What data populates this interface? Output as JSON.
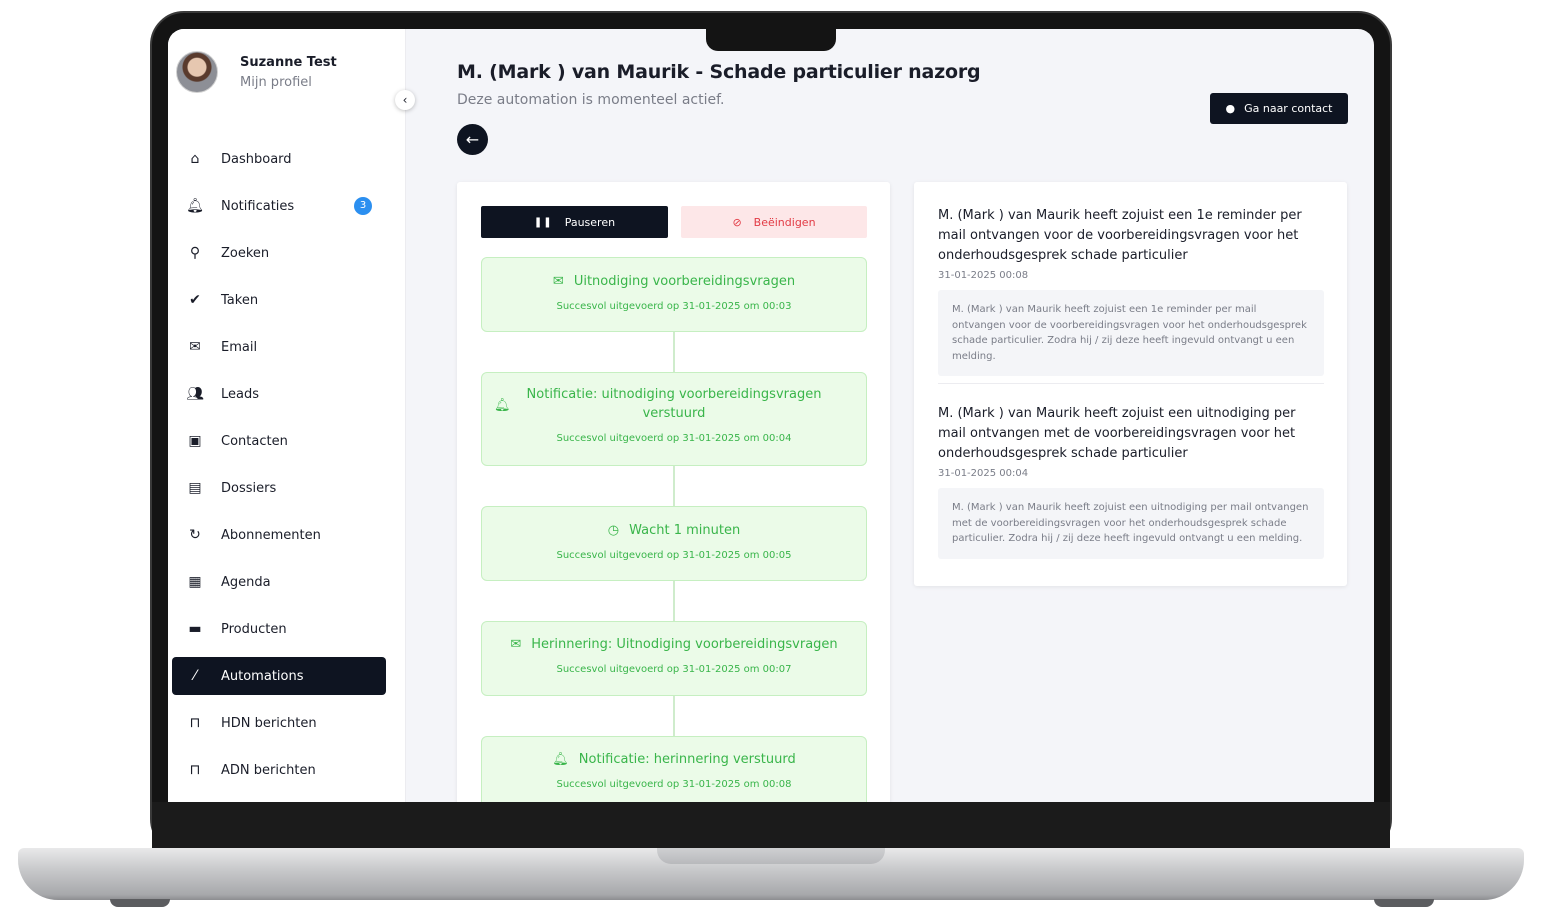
{
  "profile": {
    "name": "Suzanne Test",
    "subtitle": "Mijn profiel"
  },
  "nav": [
    {
      "label": "Dashboard",
      "icon": "home-icon"
    },
    {
      "label": "Notificaties",
      "icon": "bell-icon",
      "badge": "3"
    },
    {
      "label": "Zoeken",
      "icon": "search-icon"
    },
    {
      "label": "Taken",
      "icon": "check-icon"
    },
    {
      "label": "Email",
      "icon": "envelope-icon"
    },
    {
      "label": "Leads",
      "icon": "users-icon"
    },
    {
      "label": "Contacten",
      "icon": "address-book-icon"
    },
    {
      "label": "Dossiers",
      "icon": "file-icon"
    },
    {
      "label": "Abonnementen",
      "icon": "refresh-icon"
    },
    {
      "label": "Agenda",
      "icon": "calendar-icon"
    },
    {
      "label": "Producten",
      "icon": "briefcase-icon"
    },
    {
      "label": "Automations",
      "icon": "magic-wand-icon",
      "active": true
    },
    {
      "label": "HDN berichten",
      "icon": "inbox-icon"
    },
    {
      "label": "ADN berichten",
      "icon": "inbox-icon"
    }
  ],
  "header": {
    "title": "M. (Mark ) van Maurik - Schade particulier nazorg",
    "subtitle": "Deze automation is momenteel actief.",
    "contact_button": "Ga naar contact"
  },
  "actions": {
    "pause": "Pauseren",
    "stop": "Beëindigen"
  },
  "steps": [
    {
      "title": "Uitnodiging voorbereidingsvragen",
      "status": "Succesvol uitgevoerd op 31-01-2025 om 00:03",
      "icon": "envelope-icon"
    },
    {
      "title": "Notificatie: uitnodiging voorbereidingsvragen verstuurd",
      "status": "Succesvol uitgevoerd op 31-01-2025 om 00:04",
      "icon": "bell-icon"
    },
    {
      "title": "Wacht 1 minuten",
      "status": "Succesvol uitgevoerd op 31-01-2025 om 00:05",
      "icon": "clock-icon"
    },
    {
      "title": "Herinnering: Uitnodiging voorbereidingsvragen",
      "status": "Succesvol uitgevoerd op 31-01-2025 om 00:07",
      "icon": "envelope-icon"
    },
    {
      "title": "Notificatie: herinnering verstuurd",
      "status": "Succesvol uitgevoerd op 31-01-2025 om 00:08",
      "icon": "bell-icon"
    }
  ],
  "logs": [
    {
      "title": "M. (Mark ) van Maurik heeft zojuist een 1e reminder per mail ontvangen voor de voorbereidingsvragen voor het onderhoudsgesprek schade particulier",
      "date": "31-01-2025 00:08",
      "body": "M. (Mark ) van Maurik heeft zojuist een 1e reminder per mail ontvangen voor de voorbereidingsvragen voor het onderhoudsgesprek schade particulier. Zodra hij / zij deze heeft ingevuld ontvangt u een melding."
    },
    {
      "title": "M. (Mark ) van Maurik heeft zojuist een uitnodiging per mail ontvangen met de voorbereidingsvragen voor het onderhoudsgesprek schade particulier",
      "date": "31-01-2025 00:04",
      "body": "M. (Mark ) van Maurik heeft zojuist een uitnodiging per mail ontvangen met de voorbereidingsvragen voor het onderhoudsgesprek schade particulier. Zodra hij / zij deze heeft ingevuld ontvangt u een melding."
    }
  ],
  "colors": {
    "primary": "#0e1421",
    "success": "#39b54a",
    "success_bg": "#ebfbe8",
    "danger": "#e23b45",
    "badge": "#2b8ff0"
  }
}
